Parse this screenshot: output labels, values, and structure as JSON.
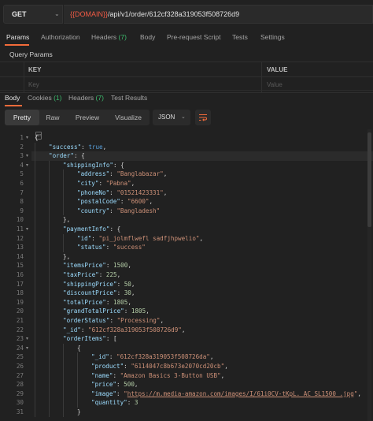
{
  "request": {
    "method": "GET",
    "url_variable": "{{DOMAIN}}",
    "url_path": "/api/v1/order/612cf328a319053f508726d9"
  },
  "request_tabs": [
    {
      "label": "Params",
      "count": ""
    },
    {
      "label": "Authorization",
      "count": ""
    },
    {
      "label": "Headers",
      "count": "(7)"
    },
    {
      "label": "Body",
      "count": ""
    },
    {
      "label": "Pre-request Script",
      "count": ""
    },
    {
      "label": "Tests",
      "count": ""
    },
    {
      "label": "Settings",
      "count": ""
    }
  ],
  "query_params": {
    "title": "Query Params",
    "headers": {
      "key": "KEY",
      "value": "VALUE"
    },
    "placeholder": {
      "key": "Key",
      "value": "Value"
    }
  },
  "response_tabs": [
    {
      "label": "Body",
      "count": ""
    },
    {
      "label": "Cookies",
      "count": "(1)"
    },
    {
      "label": "Headers",
      "count": "(7)"
    },
    {
      "label": "Test Results",
      "count": ""
    }
  ],
  "view_modes": [
    "Pretty",
    "Raw",
    "Preview",
    "Visualize"
  ],
  "format": "JSON",
  "colors": {
    "accent": "#f26b3a",
    "count_green": "#3dbd6e",
    "url_var": "#f05a44",
    "key": "#9cdcfe",
    "string": "#ce9178",
    "number": "#b5cea8"
  },
  "code_lines": [
    {
      "n": "1",
      "indent": 0,
      "parts": [
        [
          "p",
          "{"
        ]
      ]
    },
    {
      "n": "2",
      "indent": 1,
      "parts": [
        [
          "k",
          "\"success\""
        ],
        [
          "p",
          ": "
        ],
        [
          "b",
          "true"
        ],
        [
          "p",
          ","
        ]
      ]
    },
    {
      "n": "3",
      "indent": 1,
      "parts": [
        [
          "k",
          "\"order\""
        ],
        [
          "p",
          ": {"
        ]
      ]
    },
    {
      "n": "4",
      "indent": 2,
      "parts": [
        [
          "k",
          "\"shippingInfo\""
        ],
        [
          "p",
          ": {"
        ]
      ]
    },
    {
      "n": "5",
      "indent": 3,
      "parts": [
        [
          "k",
          "\"address\""
        ],
        [
          "p",
          ": "
        ],
        [
          "s",
          "\"Banglabazar\""
        ],
        [
          "p",
          ","
        ]
      ]
    },
    {
      "n": "6",
      "indent": 3,
      "parts": [
        [
          "k",
          "\"city\""
        ],
        [
          "p",
          ": "
        ],
        [
          "s",
          "\"Pabna\""
        ],
        [
          "p",
          ","
        ]
      ]
    },
    {
      "n": "7",
      "indent": 3,
      "parts": [
        [
          "k",
          "\"phoneNo\""
        ],
        [
          "p",
          ": "
        ],
        [
          "s",
          "\"01521423331\""
        ],
        [
          "p",
          ","
        ]
      ]
    },
    {
      "n": "8",
      "indent": 3,
      "parts": [
        [
          "k",
          "\"postalCode\""
        ],
        [
          "p",
          ": "
        ],
        [
          "s",
          "\"6600\""
        ],
        [
          "p",
          ","
        ]
      ]
    },
    {
      "n": "9",
      "indent": 3,
      "parts": [
        [
          "k",
          "\"country\""
        ],
        [
          "p",
          ": "
        ],
        [
          "s",
          "\"Bangladesh\""
        ]
      ]
    },
    {
      "n": "10",
      "indent": 2,
      "parts": [
        [
          "p",
          "},"
        ]
      ]
    },
    {
      "n": "11",
      "indent": 2,
      "parts": [
        [
          "k",
          "\"paymentInfo\""
        ],
        [
          "p",
          ": {"
        ]
      ]
    },
    {
      "n": "12",
      "indent": 3,
      "parts": [
        [
          "k",
          "\"id\""
        ],
        [
          "p",
          ": "
        ],
        [
          "s",
          "\"pi_jolmflwefl sadfjhpwelio\""
        ],
        [
          "p",
          ","
        ]
      ]
    },
    {
      "n": "13",
      "indent": 3,
      "parts": [
        [
          "k",
          "\"status\""
        ],
        [
          "p",
          ": "
        ],
        [
          "s",
          "\"success\""
        ]
      ]
    },
    {
      "n": "14",
      "indent": 2,
      "parts": [
        [
          "p",
          "},"
        ]
      ]
    },
    {
      "n": "15",
      "indent": 2,
      "parts": [
        [
          "k",
          "\"itemsPrice\""
        ],
        [
          "p",
          ": "
        ],
        [
          "n",
          "1500"
        ],
        [
          "p",
          ","
        ]
      ]
    },
    {
      "n": "16",
      "indent": 2,
      "parts": [
        [
          "k",
          "\"taxPrice\""
        ],
        [
          "p",
          ": "
        ],
        [
          "n",
          "225"
        ],
        [
          "p",
          ","
        ]
      ]
    },
    {
      "n": "17",
      "indent": 2,
      "parts": [
        [
          "k",
          "\"shippingPrice\""
        ],
        [
          "p",
          ": "
        ],
        [
          "n",
          "50"
        ],
        [
          "p",
          ","
        ]
      ]
    },
    {
      "n": "18",
      "indent": 2,
      "parts": [
        [
          "k",
          "\"discountPrice\""
        ],
        [
          "p",
          ": "
        ],
        [
          "n",
          "30"
        ],
        [
          "p",
          ","
        ]
      ]
    },
    {
      "n": "19",
      "indent": 2,
      "parts": [
        [
          "k",
          "\"totalPrice\""
        ],
        [
          "p",
          ": "
        ],
        [
          "n",
          "1805"
        ],
        [
          "p",
          ","
        ]
      ]
    },
    {
      "n": "20",
      "indent": 2,
      "parts": [
        [
          "k",
          "\"grandTotalPrice\""
        ],
        [
          "p",
          ": "
        ],
        [
          "n",
          "1805"
        ],
        [
          "p",
          ","
        ]
      ]
    },
    {
      "n": "21",
      "indent": 2,
      "parts": [
        [
          "k",
          "\"orderStatus\""
        ],
        [
          "p",
          ": "
        ],
        [
          "s",
          "\"Processing\""
        ],
        [
          "p",
          ","
        ]
      ]
    },
    {
      "n": "22",
      "indent": 2,
      "parts": [
        [
          "k",
          "\"_id\""
        ],
        [
          "p",
          ": "
        ],
        [
          "s",
          "\"612cf328a319053f508726d9\""
        ],
        [
          "p",
          ","
        ]
      ]
    },
    {
      "n": "23",
      "indent": 2,
      "parts": [
        [
          "k",
          "\"orderItems\""
        ],
        [
          "p",
          ": ["
        ]
      ]
    },
    {
      "n": "24",
      "indent": 3,
      "parts": [
        [
          "p",
          "{"
        ]
      ]
    },
    {
      "n": "25",
      "indent": 4,
      "parts": [
        [
          "k",
          "\"_id\""
        ],
        [
          "p",
          ": "
        ],
        [
          "s",
          "\"612cf328a319053f508726da\""
        ],
        [
          "p",
          ","
        ]
      ]
    },
    {
      "n": "26",
      "indent": 4,
      "parts": [
        [
          "k",
          "\"product\""
        ],
        [
          "p",
          ": "
        ],
        [
          "s",
          "\"6114047c8b673e2070cd20cb\""
        ],
        [
          "p",
          ","
        ]
      ]
    },
    {
      "n": "27",
      "indent": 4,
      "parts": [
        [
          "k",
          "\"name\""
        ],
        [
          "p",
          ": "
        ],
        [
          "s",
          "\"Amazon Basics 3-Button USB\""
        ],
        [
          "p",
          ","
        ]
      ]
    },
    {
      "n": "28",
      "indent": 4,
      "parts": [
        [
          "k",
          "\"price\""
        ],
        [
          "p",
          ": "
        ],
        [
          "n",
          "500"
        ],
        [
          "p",
          ","
        ]
      ]
    },
    {
      "n": "29",
      "indent": 4,
      "parts": [
        [
          "k",
          "\"image\""
        ],
        [
          "p",
          ": "
        ],
        [
          "s",
          "\""
        ],
        [
          "l",
          "https://m.media-amazon.com/images/I/61i0CV-tKpL._AC_SL1500_.jpg"
        ],
        [
          "s",
          "\""
        ],
        [
          "p",
          ","
        ]
      ]
    },
    {
      "n": "30",
      "indent": 4,
      "parts": [
        [
          "k",
          "\"quantity\""
        ],
        [
          "p",
          ": "
        ],
        [
          "n",
          "3"
        ]
      ]
    },
    {
      "n": "31",
      "indent": 3,
      "parts": [
        [
          "p",
          "}"
        ]
      ]
    }
  ]
}
